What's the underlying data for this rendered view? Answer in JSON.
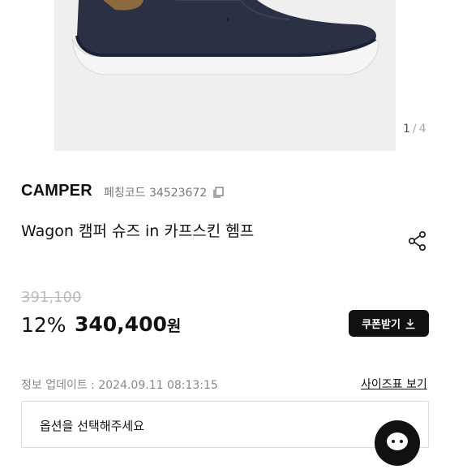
{
  "gallery": {
    "current": "1",
    "separator": "/",
    "total": "4",
    "image_icon": "shoe-image"
  },
  "product": {
    "brand": "CAMPER",
    "code": "페칭코드 34523672",
    "title": "Wagon 캠퍼 슈즈 in 카프스킨 헴프"
  },
  "pricing": {
    "original_price": "391,100",
    "discount": "12%",
    "price": "340,400",
    "currency": "원"
  },
  "coupon": {
    "label": "쿠폰받기"
  },
  "info": {
    "update": "정보 업데이트 : 2024.09.11 08:13:15",
    "size_guide": "사이즈표 보기"
  },
  "option": {
    "placeholder": "옵션을 선택해주세요"
  },
  "icons": {
    "copy": "copy-icon",
    "share": "share-icon",
    "download": "download-icon",
    "chat": "chat-icon"
  },
  "colors": {
    "primary": "#111111",
    "muted": "#888888",
    "strike": "#bbbbbb",
    "image_bg": "#efefef"
  }
}
